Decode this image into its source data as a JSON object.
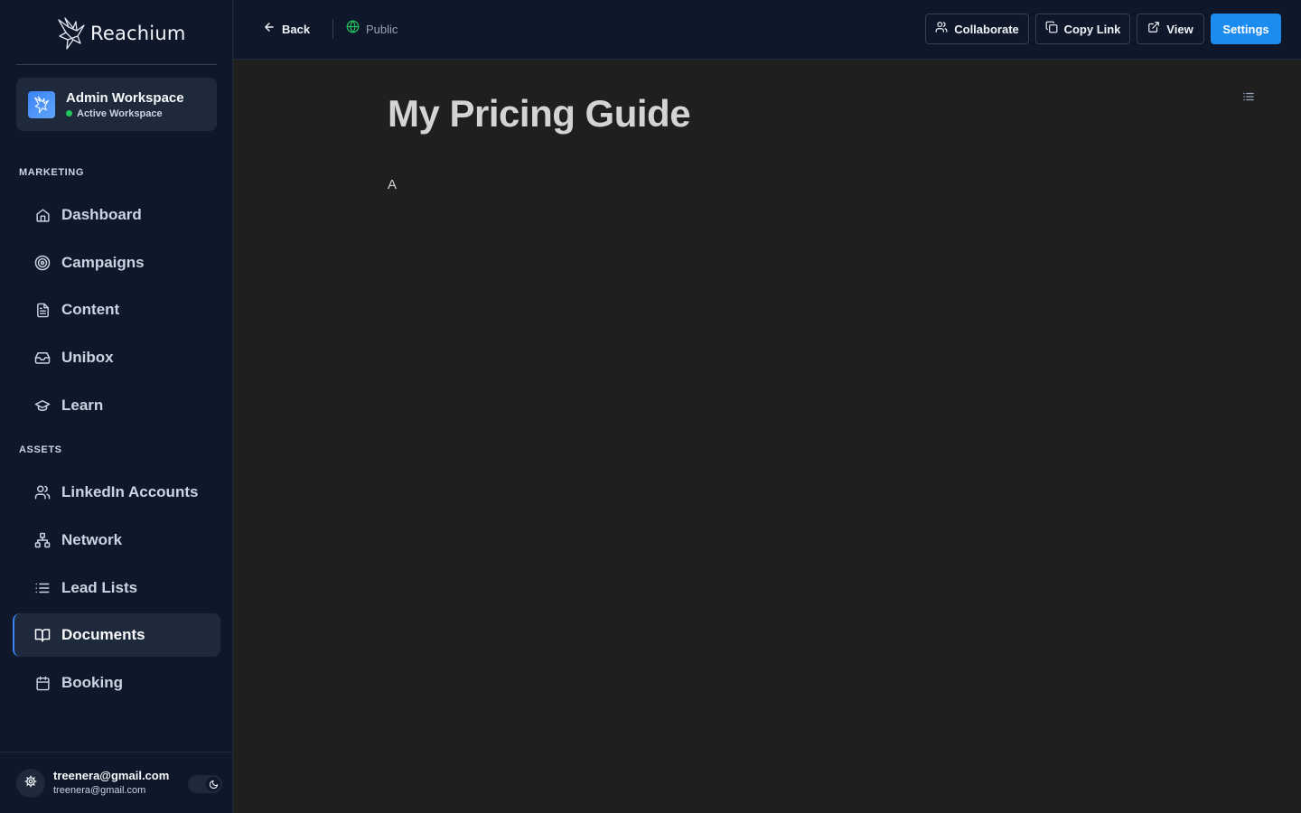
{
  "brand": {
    "name": "Reachium"
  },
  "workspace": {
    "name": "Admin Workspace",
    "status": "Active Workspace"
  },
  "sidebar": {
    "sections": [
      {
        "label": "MARKETING",
        "items": [
          {
            "label": "Dashboard",
            "icon": "home-icon"
          },
          {
            "label": "Campaigns",
            "icon": "target-icon"
          },
          {
            "label": "Content",
            "icon": "file-text-icon"
          },
          {
            "label": "Unibox",
            "icon": "inbox-icon"
          },
          {
            "label": "Learn",
            "icon": "graduation-cap-icon"
          }
        ]
      },
      {
        "label": "ASSETS",
        "items": [
          {
            "label": "LinkedIn Accounts",
            "icon": "users-icon"
          },
          {
            "label": "Network",
            "icon": "network-icon"
          },
          {
            "label": "Lead Lists",
            "icon": "list-icon"
          },
          {
            "label": "Documents",
            "icon": "book-open-icon",
            "active": true
          },
          {
            "label": "Booking",
            "icon": "calendar-icon"
          }
        ]
      }
    ]
  },
  "user": {
    "primary": "treenera@gmail.com",
    "secondary": "treenera@gmail.com"
  },
  "topbar": {
    "back": "Back",
    "visibility": "Public",
    "collaborate": "Collaborate",
    "copy_link": "Copy Link",
    "view": "View",
    "settings": "Settings"
  },
  "document": {
    "title": "My Pricing Guide",
    "body": "A"
  },
  "colors": {
    "accent": "#1d8cf0",
    "sidebar_bg": "#0f172a",
    "content_bg": "#1f1f1f",
    "status_green": "#22c55e"
  }
}
